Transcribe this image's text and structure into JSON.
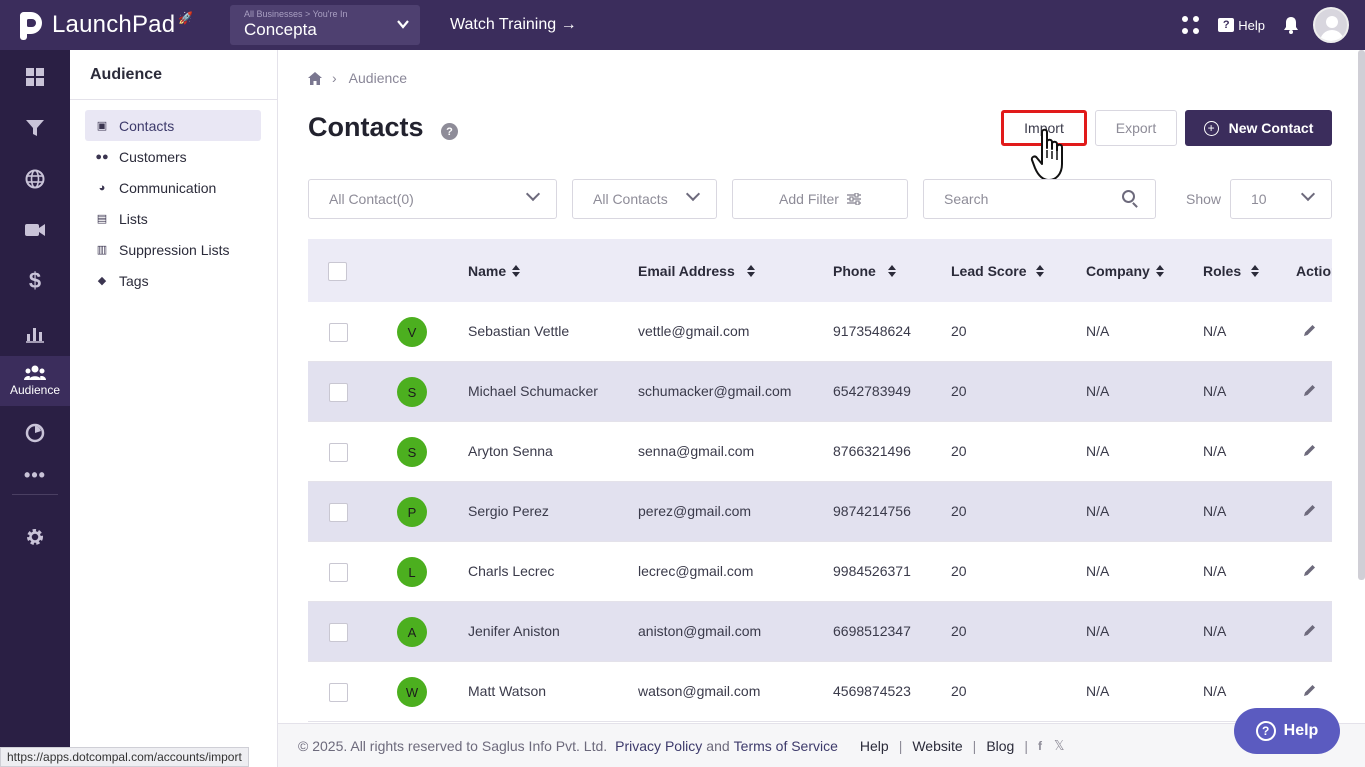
{
  "app": {
    "name": "LaunchPad",
    "business_sub": "All Businesses > You're In",
    "business_name": "Concepta",
    "watch_training": "Watch Training →",
    "help_label": "Help"
  },
  "rail": {
    "active_label": "Audience"
  },
  "sidebar": {
    "title": "Audience",
    "items": [
      {
        "label": "Contacts",
        "icon": "contacts-icon"
      },
      {
        "label": "Customers",
        "icon": "users-icon"
      },
      {
        "label": "Communication",
        "icon": "chat-icon"
      },
      {
        "label": "Lists",
        "icon": "list-icon"
      },
      {
        "label": "Suppression Lists",
        "icon": "suppression-icon"
      },
      {
        "label": "Tags",
        "icon": "tag-icon"
      }
    ]
  },
  "breadcrumb": {
    "current": "Audience"
  },
  "page": {
    "title": "Contacts",
    "help": "?"
  },
  "actions": {
    "import": "Import",
    "export": "Export",
    "new_contact": "New Contact"
  },
  "filters": {
    "contact_select": "All Contact(0)",
    "type_select": "All Contacts",
    "add_filter": "Add Filter",
    "search_placeholder": "Search",
    "show_label": "Show",
    "show_value": "10"
  },
  "table": {
    "columns": {
      "name": "Name",
      "email": "Email Address",
      "phone": "Phone",
      "lead_score": "Lead Score",
      "company": "Company",
      "roles": "Roles",
      "actions": "Action"
    },
    "rows": [
      {
        "initial": "V",
        "name": "Sebastian Vettle",
        "email": "vettle@gmail.com",
        "phone": "9173548624",
        "lead_score": "20",
        "company": "N/A",
        "roles": "N/A"
      },
      {
        "initial": "S",
        "name": "Michael Schumacker",
        "email": "schumacker@gmail.com",
        "phone": "6542783949",
        "lead_score": "20",
        "company": "N/A",
        "roles": "N/A"
      },
      {
        "initial": "S",
        "name": "Aryton Senna",
        "email": "senna@gmail.com",
        "phone": "8766321496",
        "lead_score": "20",
        "company": "N/A",
        "roles": "N/A"
      },
      {
        "initial": "P",
        "name": "Sergio Perez",
        "email": "perez@gmail.com",
        "phone": "9874214756",
        "lead_score": "20",
        "company": "N/A",
        "roles": "N/A"
      },
      {
        "initial": "L",
        "name": "Charls Lecrec",
        "email": "lecrec@gmail.com",
        "phone": "9984526371",
        "lead_score": "20",
        "company": "N/A",
        "roles": "N/A"
      },
      {
        "initial": "A",
        "name": "Jenifer Aniston",
        "email": "aniston@gmail.com",
        "phone": "6698512347",
        "lead_score": "20",
        "company": "N/A",
        "roles": "N/A"
      },
      {
        "initial": "W",
        "name": "Matt Watson",
        "email": "watson@gmail.com",
        "phone": "4569874523",
        "lead_score": "20",
        "company": "N/A",
        "roles": "N/A"
      }
    ]
  },
  "footer": {
    "copyright": "© 2025. All rights reserved to Saglus Info Pvt. Ltd.",
    "privacy": "Privacy Policy",
    "and": "and",
    "terms": "Terms of Service",
    "help": "Help",
    "website": "Website",
    "blog": "Blog"
  },
  "help_button": "Help",
  "status_url": "https://apps.dotcompal.com/accounts/import",
  "colors": {
    "brand": "#3b2d5c",
    "rail": "#2a1f44",
    "avatar_green": "#4caf1f",
    "highlight_red": "#e11a1a",
    "help_float": "#5b5bc0"
  }
}
